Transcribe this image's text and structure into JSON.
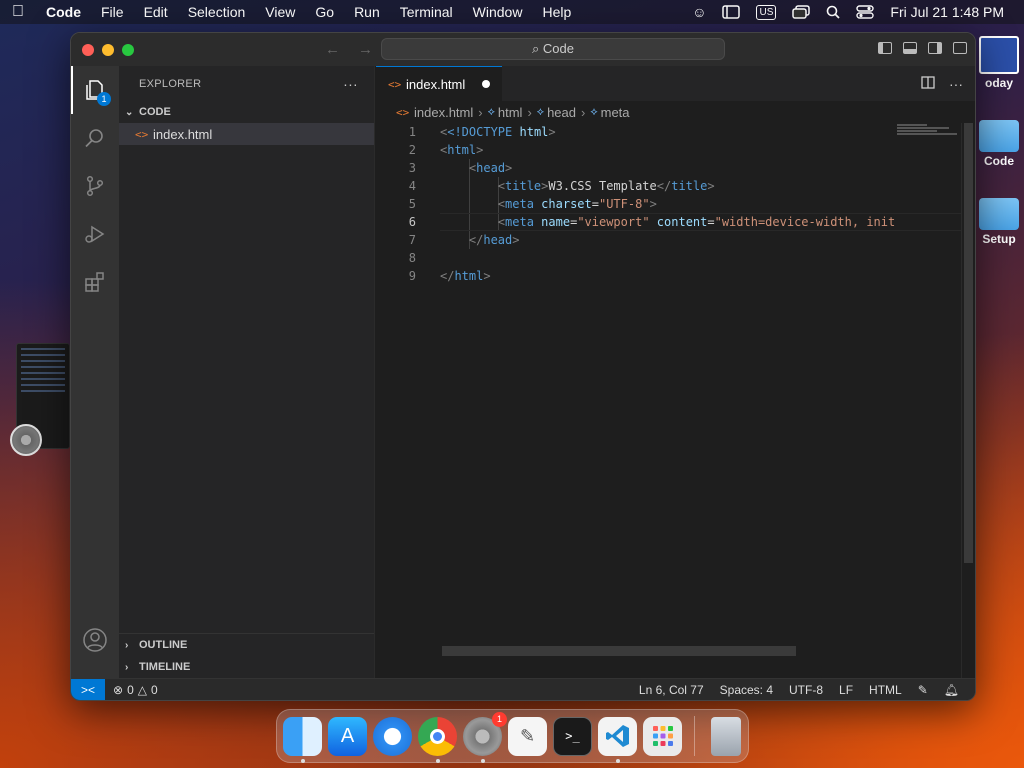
{
  "menubar": {
    "app_name": "Code",
    "menus": [
      "File",
      "Edit",
      "Selection",
      "View",
      "Go",
      "Run",
      "Terminal",
      "Window",
      "Help"
    ],
    "input_source": "US",
    "clock": "Fri Jul 21  1:48 PM"
  },
  "desktop": {
    "items": [
      "oday",
      "Code",
      "Setup"
    ]
  },
  "window": {
    "command_center": "Code",
    "explorer_title": "EXPLORER",
    "explorer_badge": "1",
    "folder_name": "CODE",
    "files": [
      "index.html"
    ],
    "outline_label": "OUTLINE",
    "timeline_label": "TIMELINE",
    "tab_label": "index.html",
    "breadcrumb": [
      "index.html",
      "html",
      "head",
      "meta"
    ],
    "code_lines": [
      {
        "n": "1"
      },
      {
        "n": "2"
      },
      {
        "n": "3"
      },
      {
        "n": "4"
      },
      {
        "n": "5"
      },
      {
        "n": "6"
      },
      {
        "n": "7"
      },
      {
        "n": "8"
      },
      {
        "n": "9"
      }
    ],
    "code": {
      "l1_doctype": "<!DOCTYPE",
      "l1_html": " html",
      "l4_title_text": "W3.CSS Template",
      "l5_charset": "\"UTF-8\"",
      "l6_name": "\"viewport\"",
      "l6_content": "\"width=device-width, init"
    },
    "status": {
      "errors": "0",
      "warnings": "0",
      "position": "Ln 6, Col 77",
      "spaces": "Spaces: 4",
      "encoding": "UTF-8",
      "eol": "LF",
      "language": "HTML"
    }
  },
  "dock": {
    "settings_badge": "1"
  },
  "colors": {
    "accent": "#0078d4",
    "tag": "#569cd6",
    "attr": "#9cdcfe",
    "string": "#ce9178",
    "html_icon": "#e37933"
  }
}
